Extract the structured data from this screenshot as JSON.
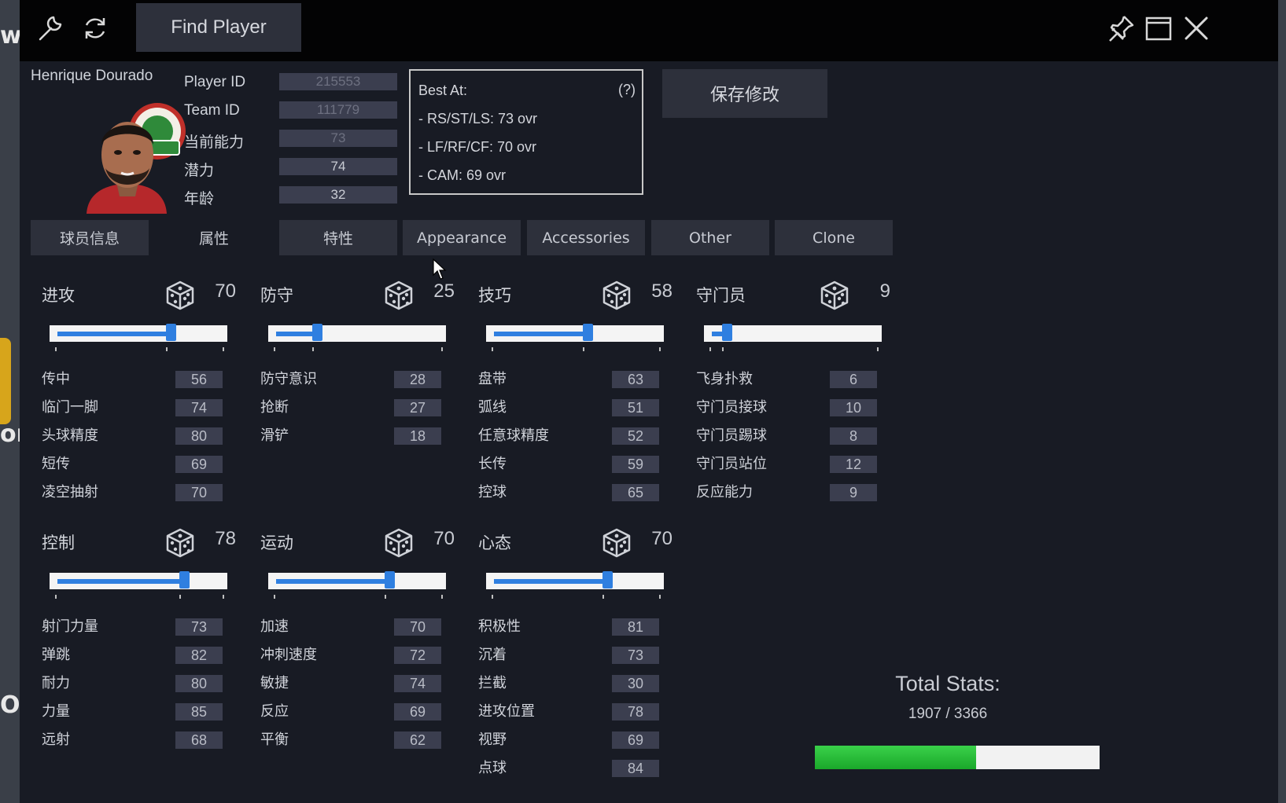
{
  "window": {
    "find_player_label": "Find Player",
    "icons": [
      "wrench-icon",
      "refresh-icon",
      "pin-icon",
      "maximize-icon",
      "close-icon"
    ]
  },
  "player": {
    "name": "Henrique Dourado",
    "fields": [
      {
        "label": "Player ID",
        "value": "215553"
      },
      {
        "label": "Team ID",
        "value": "111779"
      },
      {
        "label": "当前能力",
        "value": "73"
      },
      {
        "label": "潜力",
        "value": "74"
      },
      {
        "label": "年龄",
        "value": "32"
      }
    ]
  },
  "best_at": {
    "title": "Best At:",
    "help": "(?)",
    "lines": [
      "- RS/ST/LS: 73 ovr",
      "- LF/RF/CF: 70 ovr",
      "- CAM: 69 ovr"
    ]
  },
  "save_label": "保存修改",
  "tabs": [
    "球员信息",
    "属性",
    "特性",
    "Appearance",
    "Accessories",
    "Other",
    "Clone"
  ],
  "active_tab": "属性",
  "sections": [
    {
      "title": "进攻",
      "value": "70",
      "level": 0.7,
      "attrs": [
        [
          "传中",
          "56"
        ],
        [
          "临门一脚",
          "74"
        ],
        [
          "头球精度",
          "80"
        ],
        [
          "短传",
          "69"
        ],
        [
          "凌空抽射",
          "70"
        ]
      ]
    },
    {
      "title": "防守",
      "value": "25",
      "level": 0.25,
      "attrs": [
        [
          "防守意识",
          "28"
        ],
        [
          "抢断",
          "27"
        ],
        [
          "滑铲",
          "18"
        ]
      ]
    },
    {
      "title": "技巧",
      "value": "58",
      "level": 0.58,
      "attrs": [
        [
          "盘带",
          "63"
        ],
        [
          "弧线",
          "51"
        ],
        [
          "任意球精度",
          "52"
        ],
        [
          "长传",
          "59"
        ],
        [
          "控球",
          "65"
        ]
      ]
    },
    {
      "title": "守门员",
      "value": "9",
      "level": 0.09,
      "attrs": [
        [
          "飞身扑救",
          "6"
        ],
        [
          "守门员接球",
          "10"
        ],
        [
          "守门员踢球",
          "8"
        ],
        [
          "守门员站位",
          "12"
        ],
        [
          "反应能力",
          "9"
        ]
      ]
    },
    {
      "title": "控制",
      "value": "78",
      "level": 0.78,
      "attrs": [
        [
          "射门力量",
          "73"
        ],
        [
          "弹跳",
          "82"
        ],
        [
          "耐力",
          "80"
        ],
        [
          "力量",
          "85"
        ],
        [
          "远射",
          "68"
        ]
      ]
    },
    {
      "title": "运动",
      "value": "70",
      "level": 0.7,
      "attrs": [
        [
          "加速",
          "70"
        ],
        [
          "冲刺速度",
          "72"
        ],
        [
          "敏捷",
          "74"
        ],
        [
          "反应",
          "69"
        ],
        [
          "平衡",
          "62"
        ]
      ]
    },
    {
      "title": "心态",
      "value": "70",
      "level": 0.7,
      "attrs": [
        [
          "积极性",
          "81"
        ],
        [
          "沉着",
          "73"
        ],
        [
          "拦截",
          "30"
        ],
        [
          "进攻位置",
          "78"
        ],
        [
          "视野",
          "69"
        ],
        [
          "点球",
          "84"
        ]
      ]
    }
  ],
  "total": {
    "title": "Total Stats:",
    "value": "1907 / 3366",
    "fraction": 0.5666
  },
  "background_fragments": [
    "w",
    "or",
    "OC"
  ]
}
